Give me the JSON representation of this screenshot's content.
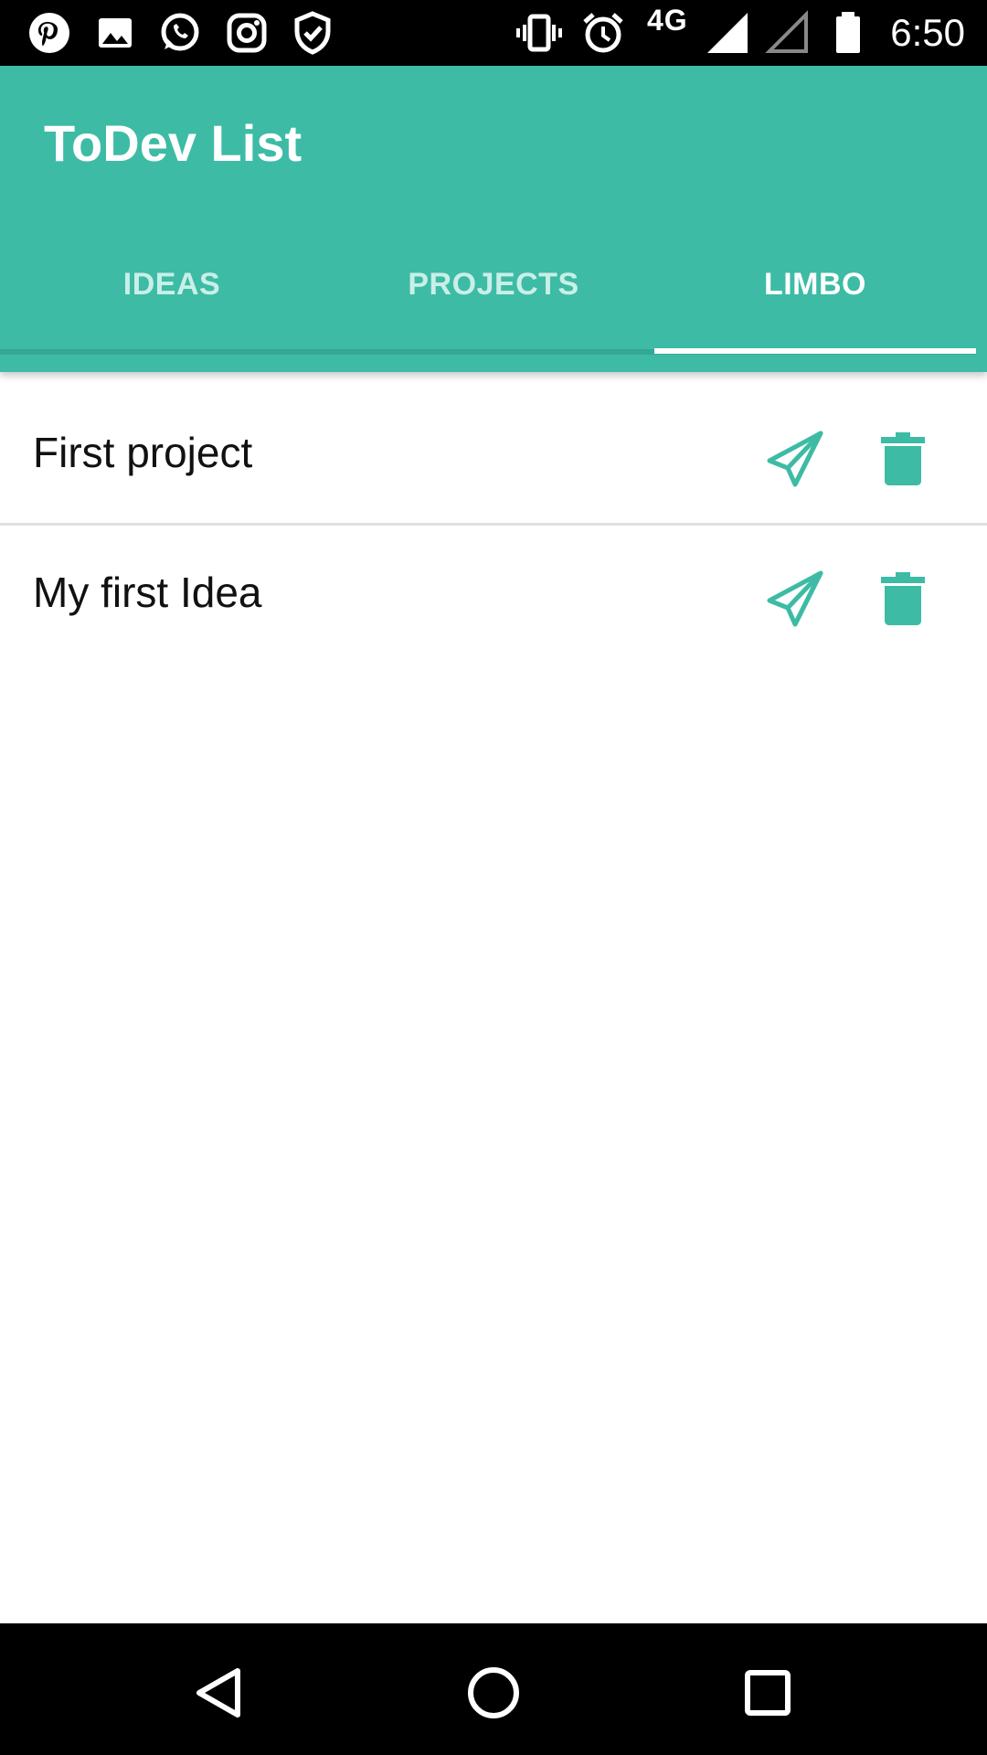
{
  "status_bar": {
    "network": "4G",
    "time": "6:50",
    "icons": [
      "pinterest-icon",
      "gallery-icon",
      "whatsapp-icon",
      "instagram-icon",
      "shield-check-icon",
      "vibrate-icon",
      "alarm-icon",
      "signal-icon",
      "signal-empty-icon",
      "battery-icon"
    ]
  },
  "app_bar": {
    "title": "ToDev List",
    "color": "#3dbba5"
  },
  "tabs": [
    {
      "label": "IDEAS",
      "active": false
    },
    {
      "label": "PROJECTS",
      "active": false
    },
    {
      "label": "LIMBO",
      "active": true
    }
  ],
  "list": {
    "items": [
      {
        "title": "First project",
        "actions": [
          "send-icon",
          "trash-icon"
        ]
      },
      {
        "title": "My first Idea",
        "actions": [
          "send-icon",
          "trash-icon"
        ]
      }
    ]
  },
  "nav_bar": {
    "buttons": [
      "back-icon",
      "home-icon",
      "recent-apps-icon"
    ]
  }
}
